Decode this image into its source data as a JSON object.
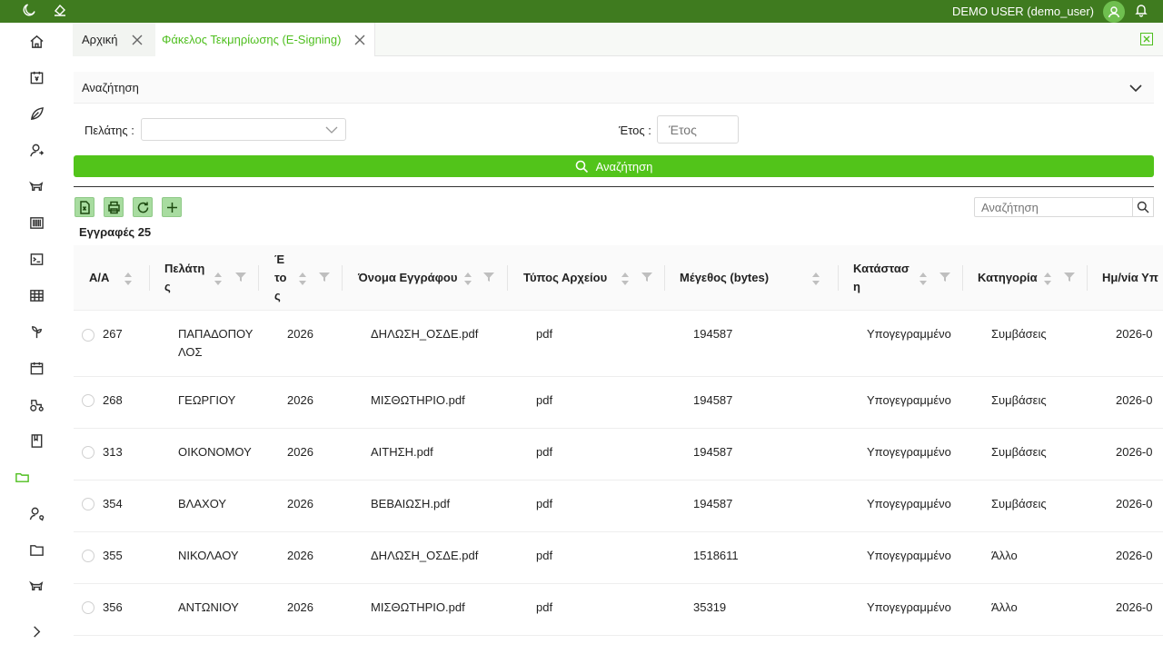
{
  "topbar": {
    "user": "DEMO USER (demo_user)"
  },
  "tabs": [
    {
      "label": "Αρχική"
    },
    {
      "label": "Φάκελος Τεκμηρίωσης (E-Signing)"
    }
  ],
  "search": {
    "header": "Αναζήτηση",
    "client_label": "Πελάτης :",
    "client_value": "",
    "year_label": "Έτος :",
    "year_placeholder": "Έτος",
    "button_label": "Αναζήτηση"
  },
  "toolbar": {
    "records_label": "Εγγραφές 25",
    "table_search_placeholder": "Αναζήτηση"
  },
  "table": {
    "columns": [
      {
        "label": "Α/Α"
      },
      {
        "label": "Πελάτης"
      },
      {
        "label": "Έτος"
      },
      {
        "label": "Όνομα Εγγράφου"
      },
      {
        "label": "Τύπος Αρχείου"
      },
      {
        "label": "Μέγεθος (bytes)"
      },
      {
        "label": "Κατάσταση"
      },
      {
        "label": "Κατηγορία"
      },
      {
        "label": "Ημ/νία Υπ"
      }
    ],
    "rows": [
      {
        "aa": "267",
        "client": "ΠΑΠΑΔΟΠΟΥΛΟΣ",
        "year": "2026",
        "doc": "ΔΗΛΩΣΗ_ΟΣΔΕ.pdf",
        "type": "pdf",
        "size": "194587",
        "status": "Υπογεγραμμένο",
        "category": "Συμβάσεις",
        "date": "2026-0"
      },
      {
        "aa": "268",
        "client": "ΓΕΩΡΓΙΟΥ",
        "year": "2026",
        "doc": "ΜΙΣΘΩΤΗΡΙΟ.pdf",
        "type": "pdf",
        "size": "194587",
        "status": "Υπογεγραμμένο",
        "category": "Συμβάσεις",
        "date": "2026-0"
      },
      {
        "aa": "313",
        "client": "ΟΙΚΟΝΟΜΟΥ",
        "year": "2026",
        "doc": "ΑΙΤΗΣΗ.pdf",
        "type": "pdf",
        "size": "194587",
        "status": "Υπογεγραμμένο",
        "category": "Συμβάσεις",
        "date": "2026-0"
      },
      {
        "aa": "354",
        "client": "ΒΛΑΧΟΥ",
        "year": "2026",
        "doc": "ΒΕΒΑΙΩΣΗ.pdf",
        "type": "pdf",
        "size": "194587",
        "status": "Υπογεγραμμένο",
        "category": "Συμβάσεις",
        "date": "2026-0"
      },
      {
        "aa": "355",
        "client": "ΝΙΚΟΛΑΟΥ",
        "year": "2026",
        "doc": "ΔΗΛΩΣΗ_ΟΣΔΕ.pdf",
        "type": "pdf",
        "size": "1518611",
        "status": "Υπογεγραμμένο",
        "category": "Άλλο",
        "date": "2026-0"
      },
      {
        "aa": "356",
        "client": "ΑΝΤΩΝΙΟΥ",
        "year": "2026",
        "doc": "ΜΙΣΘΩΤΗΡΙΟ.pdf",
        "type": "pdf",
        "size": "35319",
        "status": "Υπογεγραμμένο",
        "category": "Άλλο",
        "date": "2026-0"
      }
    ]
  },
  "colors": {
    "accent": "#52c41a",
    "topbar": "#3f7b1f",
    "active_icon": "#4fbf1f"
  }
}
